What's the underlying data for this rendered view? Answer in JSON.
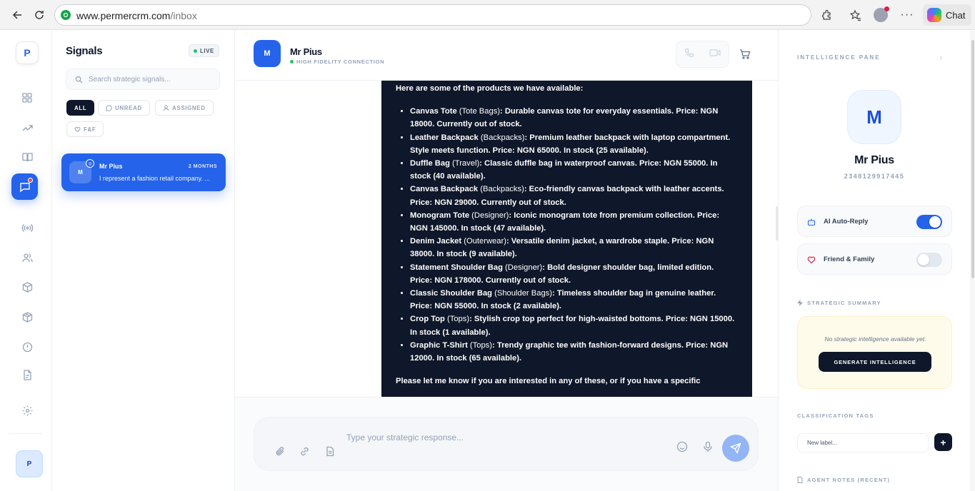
{
  "browser": {
    "url_host": "www.permercrm.com",
    "url_path": "/inbox",
    "chat_label": "Chat"
  },
  "rail": {
    "logo": "P",
    "user_initial": "P",
    "icons": [
      "dashboard-icon",
      "trending-icon",
      "book-icon",
      "messages-icon",
      "broadcast-icon",
      "users-icon",
      "box-icon",
      "package-icon",
      "alert-icon",
      "report-icon",
      "settings-icon"
    ]
  },
  "signals": {
    "title": "Signals",
    "live_label": "LIVE",
    "search_placeholder": "Search strategic signals...",
    "filters": [
      "ALL",
      "UNREAD",
      "ASSIGNED",
      "F&F"
    ],
    "conversations": [
      {
        "avatar": "M",
        "name": "Mr Pius",
        "time": "2 MONTHS",
        "preview": "I represent a fashion retail company. ..."
      }
    ]
  },
  "chat": {
    "avatar": "M",
    "name": "Mr Pius",
    "status": "HIGH FIDELITY CONNECTION",
    "message_intro": "Here are some of the products we have available:",
    "products": [
      {
        "name": "Canvas Tote",
        "category": "(Tote Bags)",
        "desc": ": Durable canvas tote for everyday essentials. Price: NGN 18000. Currently out of stock."
      },
      {
        "name": "Leather Backpack",
        "category": "(Backpacks)",
        "desc": ": Premium leather backpack with laptop compartment. Style meets function. Price: NGN 65000. In stock (25 available)."
      },
      {
        "name": "Duffle Bag",
        "category": "(Travel)",
        "desc": ": Classic duffle bag in waterproof canvas. Price: NGN 55000. In stock (40 available)."
      },
      {
        "name": "Canvas Backpack",
        "category": "(Backpacks)",
        "desc": ": Eco-friendly canvas backpack with leather accents. Price: NGN 29000. Currently out of stock."
      },
      {
        "name": "Monogram Tote",
        "category": "(Designer)",
        "desc": ": Iconic monogram tote from premium collection. Price: NGN 145000. In stock (47 available)."
      },
      {
        "name": "Denim Jacket",
        "category": "(Outerwear)",
        "desc": ": Versatile denim jacket, a wardrobe staple. Price: NGN 38000. In stock (9 available)."
      },
      {
        "name": "Statement Shoulder Bag",
        "category": "(Designer)",
        "desc": ": Bold designer shoulder bag, limited edition. Price: NGN 178000. Currently out of stock."
      },
      {
        "name": "Classic Shoulder Bag",
        "category": "(Shoulder Bags)",
        "desc": ": Timeless shoulder bag in genuine leather. Price: NGN 55000. In stock (2 available)."
      },
      {
        "name": "Crop Top",
        "category": "(Tops)",
        "desc": ": Stylish crop top perfect for high-waisted bottoms. Price: NGN 15000. In stock (1 available)."
      },
      {
        "name": "Graphic T-Shirt",
        "category": "(Tops)",
        "desc": ": Trendy graphic tee with fashion-forward designs. Price: NGN 12000. In stock (65 available)."
      }
    ],
    "message_outro": "Please let me know if you are interested in any of these, or if you have a specific",
    "composer_placeholder": "Type your strategic response..."
  },
  "intel": {
    "header": "INTELLIGENCE PANE",
    "avatar": "M",
    "name": "Mr Pius",
    "phone": "2348129917445",
    "toggles": [
      {
        "label": "AI Auto-Reply",
        "on": true
      },
      {
        "label": "Friend & Family",
        "on": false
      }
    ],
    "summary_label": "STRATEGIC SUMMARY",
    "summary_empty": "No strategic intelligence available yet.",
    "generate_label": "GENERATE INTELLIGENCE",
    "tags_label": "CLASSIFICATION TAGS",
    "tag_placeholder": "New label...",
    "notes_label": "AGENT NOTES (RECENT)",
    "accent": "#2563eb"
  }
}
